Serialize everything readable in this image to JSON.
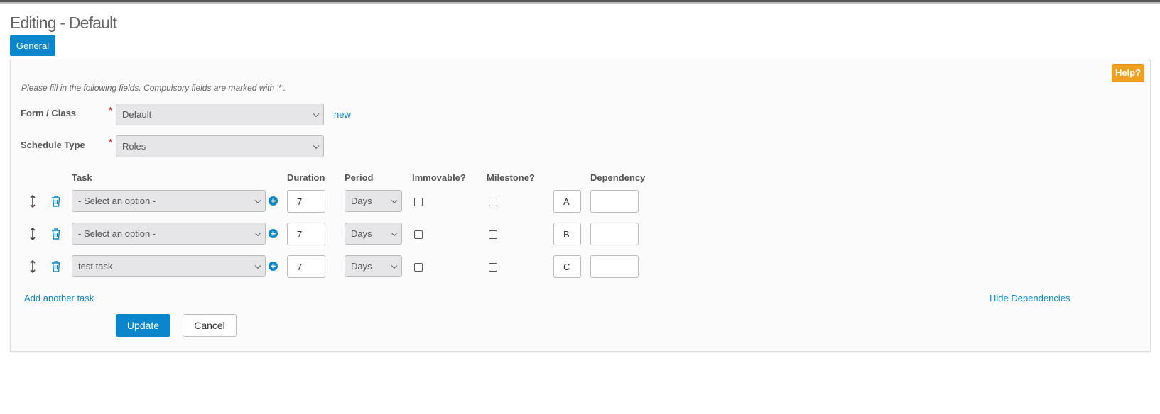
{
  "page": {
    "title": "Editing - Default"
  },
  "tabs": [
    {
      "label": "General"
    }
  ],
  "help": {
    "label": "Help?"
  },
  "form": {
    "instructions": "Please fill in the following fields. Compulsory fields are marked with '*'.",
    "form_class": {
      "label": "Form / Class",
      "required_mark": "*",
      "value": "Default",
      "new_link": "new"
    },
    "schedule_type": {
      "label": "Schedule Type",
      "required_mark": "*",
      "value": "Roles"
    }
  },
  "tasks_table": {
    "headers": {
      "task": "Task",
      "duration": "Duration",
      "period": "Period",
      "immovable": "Immovable?",
      "milestone": "Milestone?",
      "dependency": "Dependency"
    },
    "rows": [
      {
        "task": "- Select an option -",
        "duration": "7",
        "period": "Days",
        "immovable": false,
        "milestone": false,
        "letter": "A",
        "dependency": ""
      },
      {
        "task": "- Select an option -",
        "duration": "7",
        "period": "Days",
        "immovable": false,
        "milestone": false,
        "letter": "B",
        "dependency": ""
      },
      {
        "task": "test task",
        "duration": "7",
        "period": "Days",
        "immovable": false,
        "milestone": false,
        "letter": "C",
        "dependency": ""
      }
    ],
    "add_task_link": "Add another task",
    "hide_dependencies_link": "Hide Dependencies"
  },
  "actions": {
    "update": "Update",
    "cancel": "Cancel"
  },
  "colors": {
    "accent": "#0a87cc",
    "help": "#f0a020",
    "required": "#dd0000"
  }
}
